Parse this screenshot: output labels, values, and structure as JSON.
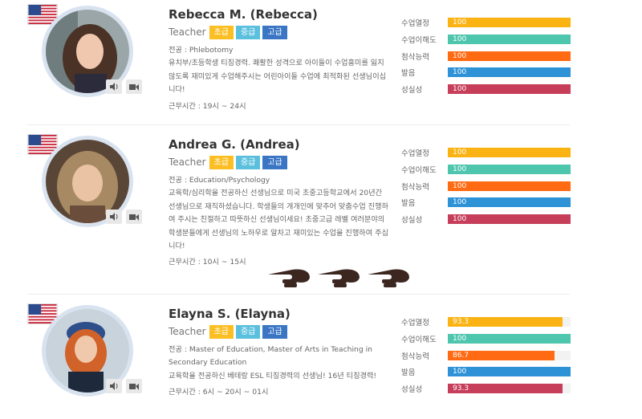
{
  "teachers": [
    {
      "name": "Rebecca M. (Rebecca)",
      "role": "Teacher",
      "levels": [
        "초급",
        "중급",
        "고급"
      ],
      "major": "전공 : Phlebotomy",
      "intro": "유치부/초등학생 티칭경력. 쾌활한 성격으로 아이들이 수업흥미를 잃지 않도록 재미있게 수업해주시는 어린아이들 수업에 최적화된 선생님이십니다!",
      "hours": "근무시간 : 19시 ~ 24시",
      "stats": [
        {
          "label": "수업열정",
          "value": "100",
          "pct": 100,
          "color": "#fbb313"
        },
        {
          "label": "수업이해도",
          "value": "100",
          "pct": 100,
          "color": "#4ec6ae"
        },
        {
          "label": "첨삭능력",
          "value": "100",
          "pct": 100,
          "color": "#ff6a13"
        },
        {
          "label": "발음",
          "value": "100",
          "pct": 100,
          "color": "#2e92d6"
        },
        {
          "label": "성실성",
          "value": "100",
          "pct": 100,
          "color": "#c63e5a"
        }
      ]
    },
    {
      "name": "Andrea G. (Andrea)",
      "role": "Teacher",
      "levels": [
        "초급",
        "중급",
        "고급"
      ],
      "major": "전공 : Education/Psychology",
      "intro": "교육학/심리학을 전공하신 선생님으로 미국 초중고등학교에서 20년간 선생님으로 재직하셨습니다. 학생들의 개개인에 맞추어 맞춤수업 진행하여 주시는 친절하고 따뜻하신 선생님이세요! 초중고급 레벨 여러분야의 학생분들에게 선생님의 노하우로 알차고 재미있는 수업을 진행하여 주십니다!",
      "hours": "근무시간 : 10시 ~ 15시",
      "stats": [
        {
          "label": "수업열정",
          "value": "100",
          "pct": 100,
          "color": "#fbb313"
        },
        {
          "label": "수업이해도",
          "value": "100",
          "pct": 100,
          "color": "#4ec6ae"
        },
        {
          "label": "첨삭능력",
          "value": "100",
          "pct": 100,
          "color": "#ff6a13"
        },
        {
          "label": "발음",
          "value": "100",
          "pct": 100,
          "color": "#2e92d6"
        },
        {
          "label": "성실성",
          "value": "100",
          "pct": 100,
          "color": "#c63e5a"
        }
      ]
    },
    {
      "name": "Elayna S. (Elayna)",
      "role": "Teacher",
      "levels": [
        "초급",
        "중급",
        "고급"
      ],
      "major": "전공 : Master of Education, Master of Arts in Teaching in Secondary Education",
      "intro": "교육학을 전공하신 베테랑 ESL 티칭경력의 선생님! 16년 티칭경력!",
      "hours": "근무시간 : 6시 ~ 20시 ~ 01시",
      "stats": [
        {
          "label": "수업열정",
          "value": "93.3",
          "pct": 93.3,
          "color": "#fbb313"
        },
        {
          "label": "수업이해도",
          "value": "100",
          "pct": 100,
          "color": "#4ec6ae"
        },
        {
          "label": "첨삭능력",
          "value": "86.7",
          "pct": 86.7,
          "color": "#ff6a13"
        },
        {
          "label": "발음",
          "value": "100",
          "pct": 100,
          "color": "#2e92d6"
        },
        {
          "label": "성실성",
          "value": "93.3",
          "pct": 93.3,
          "color": "#c63e5a"
        }
      ]
    }
  ]
}
